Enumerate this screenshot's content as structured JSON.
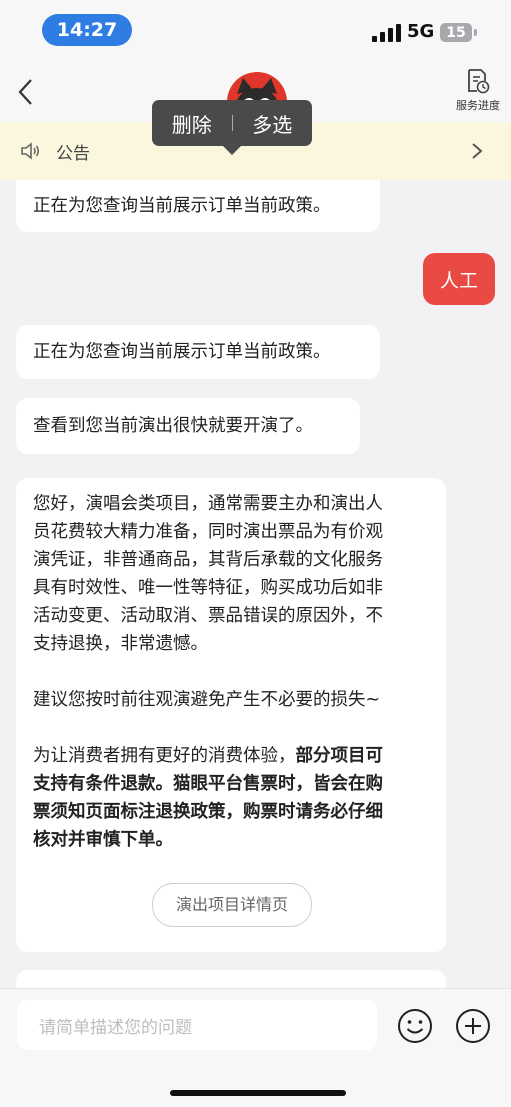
{
  "status_bar": {
    "time": "14:27",
    "network": "5G",
    "battery": "15"
  },
  "header": {
    "service_label": "服务进度",
    "icons": {
      "back": "chevron-left-icon",
      "service": "document-clock-icon",
      "avatar": "cat-mascot-avatar"
    }
  },
  "popup": {
    "delete": "删除",
    "multiselect": "多选"
  },
  "notice": {
    "label": "公告",
    "icons": {
      "speaker": "speaker-icon",
      "arrow": "chevron-right-icon"
    }
  },
  "messages": {
    "m1": "正在为您查询当前展示订单当前政策。",
    "user": "人工",
    "m2": "正在为您查询当前展示订单当前政策。",
    "m3": "查看到您当前演出很快就要开演了。",
    "long": {
      "p1": [
        "您好，演唱会类项目，通常需要主办和演出人",
        "员花费较大精力准备，同时演出票品为有价观",
        "演凭证，非普通商品，其背后承载的文化服务",
        "具有时效性、唯一性等特征，购买成功后如非",
        "活动变更、活动取消、票品错误的原因外，不",
        "支持退换，非常遗憾。"
      ],
      "p2": "建议您按时前往观演避免产生不必要的损失~",
      "p3_normal": "为让消费者拥有更好的消费体验，",
      "p3_bold_1": "部分项目可",
      "p3_bold_lines": [
        "支持有条件退款。猫眼平台售票时，",
        "票须知页面标注退换政策，",
        "核对并审慎下单。"
      ],
      "p3_tail_1": "皆会在购",
      "p3_tail_2": "购票时请务必仔细",
      "button": "演出项目详情页"
    }
  },
  "input": {
    "placeholder": "请简单描述您的问题",
    "icons": {
      "emoji": "smiley-icon",
      "plus": "plus-circle-icon"
    }
  },
  "colors": {
    "accent_red": "#e94a43",
    "time_pill": "#2f7de3",
    "notice_bg": "#fbf7df"
  }
}
